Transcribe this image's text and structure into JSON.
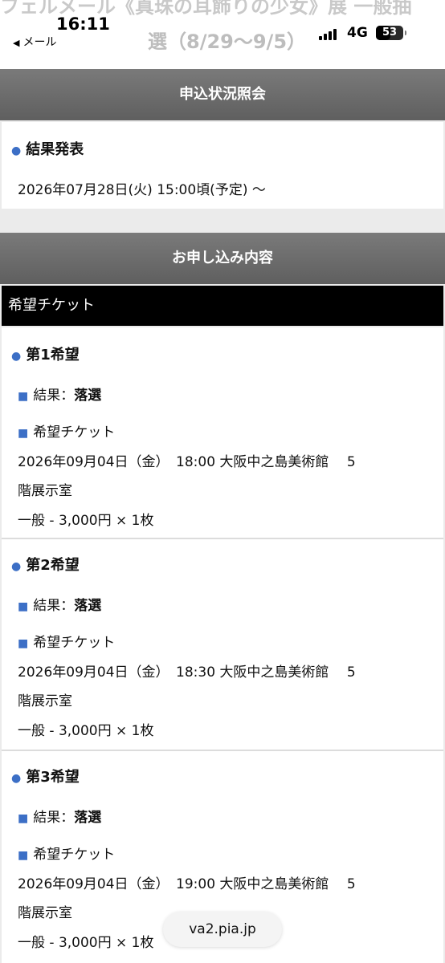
{
  "status_bar": {
    "page_title_line1": "フェルメール《真珠の耳飾りの少女》展 一般抽",
    "page_title_line2": "選（8/29〜9/5）",
    "time": "16:11",
    "back_label": "メール",
    "network": "4G",
    "battery": "53"
  },
  "inquiry": {
    "header": "申込状況照会",
    "result_title": "結果発表",
    "result_date": "2026年07月28日(火) 15:00頃(予定) 〜"
  },
  "application": {
    "header": "お申し込み内容",
    "ticket_bar": "希望チケット",
    "choices": [
      {
        "title": "第1希望",
        "result_label": "結果：",
        "result_value": "落選",
        "ticket_label": "希望チケット",
        "datetime_venue": "2026年09月04日（金）　18:00  大阪中之島美術館　 5",
        "room": "階展示室",
        "price": "一般 - 3,000円 × 1枚"
      },
      {
        "title": "第2希望",
        "result_label": "結果：",
        "result_value": "落選",
        "ticket_label": "希望チケット",
        "datetime_venue": "2026年09月04日（金）　18:30  大阪中之島美術館　 5",
        "room": "階展示室",
        "price": "一般 - 3,000円 × 1枚"
      },
      {
        "title": "第3希望",
        "result_label": "結果：",
        "result_value": "落選",
        "ticket_label": "希望チケット",
        "datetime_venue": "2026年09月04日（金）　19:00  大阪中之島美術館　 5",
        "room": "階展示室",
        "price": "一般 - 3,000円 × 1枚"
      }
    ]
  },
  "browser": {
    "url": "va2.pia.jp"
  },
  "colors": {
    "accent": "#3c6fc6",
    "header_bg": "#6b6b6b",
    "bar_bg": "#000000"
  }
}
